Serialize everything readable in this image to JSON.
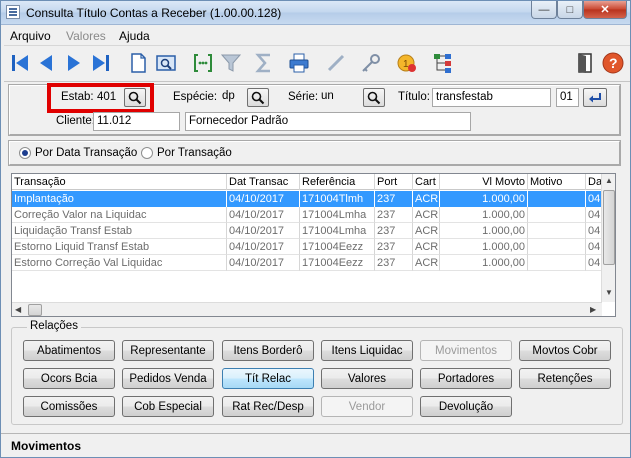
{
  "window": {
    "title": "Consulta Título Contas a Receber (1.00.00.128)",
    "controls": {
      "minimize": "—",
      "maximize": "□",
      "close": "✕"
    }
  },
  "menu": [
    {
      "label": "Arquivo",
      "disabled": false
    },
    {
      "label": "Valores",
      "disabled": true
    },
    {
      "label": "Ajuda",
      "disabled": false
    }
  ],
  "toolbar": {
    "icons": [
      "first-icon",
      "previous-icon",
      "next-icon",
      "last-icon",
      "document-icon",
      "zoom-screen-icon",
      "bracket-icon",
      "filter-icon",
      "sum-icon",
      "print-icon",
      "pen-icon",
      "key-icon",
      "coin-icon",
      "tree-icon",
      "exit-icon",
      "help-icon"
    ]
  },
  "header": {
    "estab_label": "Estab:",
    "estab_value": "401",
    "especie_label": "Espécie:",
    "especie_value": "dp",
    "serie_label": "Série:",
    "serie_value": "un",
    "titulo_label": "Título:",
    "titulo_value": "transfestab",
    "parcela_value": "01",
    "cliente_label": "Cliente:",
    "cliente_value": "11.012",
    "cliente_nome": "Fornecedor Padrão"
  },
  "options": {
    "por_data": "Por Data Transação",
    "por_transacao": "Por Transação",
    "selected": "por_data"
  },
  "grid": {
    "columns": [
      "Transação",
      "Dat Transac",
      "Referência",
      "Port",
      "Cart",
      "Vl Movto",
      "Motivo",
      "Da"
    ],
    "rows": [
      [
        "Implantação",
        "04/10/2017",
        "171004Tlmh",
        "237",
        "ACR",
        "1.000,00",
        "",
        "04"
      ],
      [
        "Correção Valor na Liquidac",
        "04/10/2017",
        "171004Lmha",
        "237",
        "ACR",
        "1.000,00",
        "",
        "04"
      ],
      [
        "Liquidação Transf Estab",
        "04/10/2017",
        "171004Lmha",
        "237",
        "ACR",
        "1.000,00",
        "",
        "04"
      ],
      [
        "Estorno Liquid Transf Estab",
        "04/10/2017",
        "171004Eezz",
        "237",
        "ACR",
        "1.000,00",
        "",
        "04"
      ],
      [
        "Estorno Correção Val Liquidac",
        "04/10/2017",
        "171004Eezz",
        "237",
        "ACR",
        "1.000,00",
        "",
        "04"
      ]
    ],
    "selected_row": 0
  },
  "relacoes": {
    "title": "Relações",
    "buttons": [
      {
        "label": "Abatimentos",
        "state": "normal"
      },
      {
        "label": "Representante",
        "state": "normal"
      },
      {
        "label": "Itens Borderô",
        "state": "normal"
      },
      {
        "label": "Itens Liquidac",
        "state": "normal"
      },
      {
        "label": "Movimentos",
        "state": "disabled"
      },
      {
        "label": "Movtos Cobr",
        "state": "normal"
      },
      {
        "label": "Ocors Bcia",
        "state": "normal"
      },
      {
        "label": "Pedidos Venda",
        "state": "normal"
      },
      {
        "label": "Tít Relac",
        "state": "focused"
      },
      {
        "label": "Valores",
        "state": "normal"
      },
      {
        "label": "Portadores",
        "state": "normal"
      },
      {
        "label": "Retenções",
        "state": "normal"
      },
      {
        "label": "Comissões",
        "state": "normal"
      },
      {
        "label": "Cob Especial",
        "state": "normal"
      },
      {
        "label": "Rat Rec/Desp",
        "state": "normal"
      },
      {
        "label": "Vendor",
        "state": "disabled"
      },
      {
        "label": "Devolução",
        "state": "normal"
      }
    ]
  },
  "status": {
    "text": "Movimentos"
  }
}
